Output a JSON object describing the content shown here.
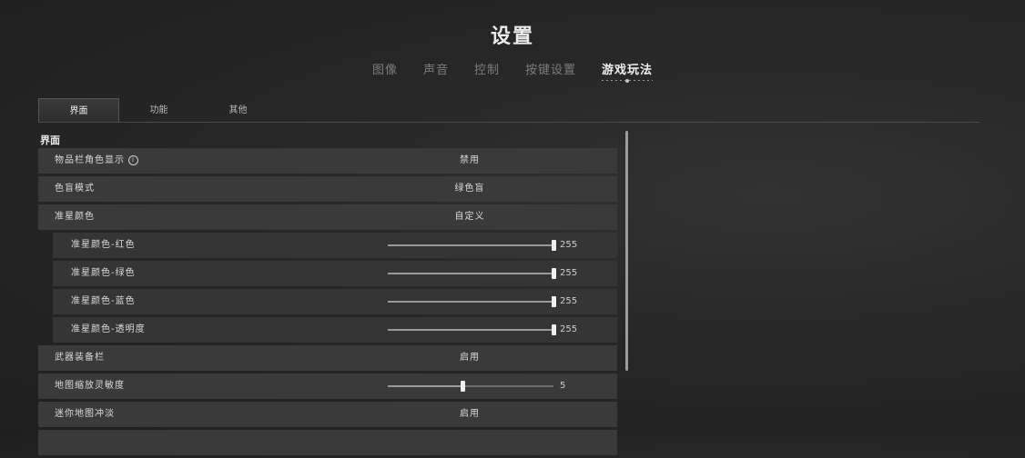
{
  "title": "设置",
  "tabs": [
    "图像",
    "声音",
    "控制",
    "按键设置",
    "游戏玩法"
  ],
  "active_tab_index": 4,
  "subtabs": [
    "界面",
    "功能",
    "其他"
  ],
  "active_subtab_index": 0,
  "section": "界面",
  "rows": [
    {
      "label": "物品栏角色显示",
      "value": "禁用",
      "info": true
    },
    {
      "label": "色盲模式",
      "value": "绿色盲"
    },
    {
      "label": "准星颜色",
      "value": "自定义"
    },
    {
      "label": "准星颜色-红色",
      "slider": 1.0,
      "slider_value": "255"
    },
    {
      "label": "准星颜色-绿色",
      "slider": 1.0,
      "slider_value": "255"
    },
    {
      "label": "准星颜色-蓝色",
      "slider": 1.0,
      "slider_value": "255"
    },
    {
      "label": "准星颜色-透明度",
      "slider": 1.0,
      "slider_value": "255"
    },
    {
      "label": "武器装备栏",
      "value": "启用"
    },
    {
      "label": "地图缩放灵敏度",
      "slider": 0.45,
      "slider_value": "5"
    },
    {
      "label": "迷你地图冲淡",
      "value": "启用"
    }
  ]
}
